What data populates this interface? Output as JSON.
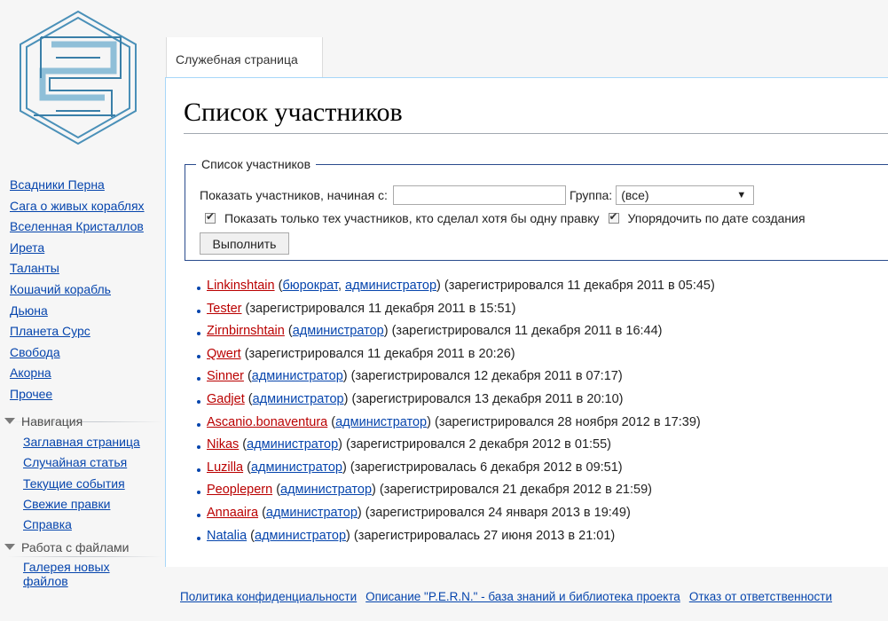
{
  "tab": {
    "label": "Служебная страница"
  },
  "page": {
    "title": "Список участников"
  },
  "form": {
    "legend": "Список участников",
    "from_label": "Показать участников, начиная с:",
    "from_value": "",
    "group_label": "Группа:",
    "group_value": "(все)",
    "edits_label": "Показать только тех участников, кто сделал хотя бы одну правку",
    "sort_label": "Упорядочить по дате создания",
    "submit_label": "Выполнить"
  },
  "sidebar": {
    "top_links": [
      "Всадники Перна",
      "Сага о живых кораблях",
      "Вселенная Кристаллов",
      "Ирета",
      "Таланты",
      "Кошачий корабль",
      "Дьюна",
      "Планета Сурс",
      "Свобода",
      "Акорна",
      "Прочее"
    ],
    "navigation": {
      "title": "Навигация",
      "items": [
        "Заглавная страница",
        "Случайная статья",
        "Текущие события",
        "Свежие правки",
        "Справка"
      ]
    },
    "files": {
      "title": "Работа с файлами",
      "items": [
        "Галерея новых файлов"
      ]
    }
  },
  "users": [
    {
      "name": "Linkinshtain",
      "state": "new",
      "groups": [
        "бюрократ",
        "администратор"
      ],
      "reg": "(зарегистрировался 11 декабря 2011 в 05:45)"
    },
    {
      "name": "Tester",
      "state": "new",
      "groups": [],
      "reg": "(зарегистрировался 11 декабря 2011 в 15:51)"
    },
    {
      "name": "Zirnbirnshtain",
      "state": "new",
      "groups": [
        "администратор"
      ],
      "reg": "(зарегистрировался 11 декабря 2011 в 16:44)"
    },
    {
      "name": "Qwert",
      "state": "new",
      "groups": [],
      "reg": "(зарегистрировался 11 декабря 2011 в 20:26)"
    },
    {
      "name": "Sinner",
      "state": "new",
      "groups": [
        "администратор"
      ],
      "reg": "(зарегистрировался 12 декабря 2011 в 07:17)"
    },
    {
      "name": "Gadjet",
      "state": "new",
      "groups": [
        "администратор"
      ],
      "reg": "(зарегистрировался 13 декабря 2011 в 20:10)"
    },
    {
      "name": "Ascanio.bonaventura",
      "state": "new",
      "groups": [
        "администратор"
      ],
      "reg": "(зарегистрировался 28 ноября 2012 в 17:39)"
    },
    {
      "name": "Nikas",
      "state": "new",
      "groups": [
        "администратор"
      ],
      "reg": "(зарегистрировался 2 декабря 2012 в 01:55)"
    },
    {
      "name": "Luzilla",
      "state": "new",
      "groups": [
        "администратор"
      ],
      "reg": "(зарегистрировалась 6 декабря 2012 в 09:51)"
    },
    {
      "name": "Peoplepern",
      "state": "new",
      "groups": [
        "администратор"
      ],
      "reg": "(зарегистрировался 21 декабря 2012 в 21:59)"
    },
    {
      "name": "Annaaira",
      "state": "new",
      "groups": [
        "администратор"
      ],
      "reg": "(зарегистрировался 24 января 2013 в 19:49)"
    },
    {
      "name": "Natalia",
      "state": "exists",
      "groups": [
        "администратор"
      ],
      "reg": "(зарегистрировалась 27 июня 2013 в 21:01)"
    }
  ],
  "footer": {
    "links": [
      "Политика конфиденциальности",
      "Описание \"P.E.R.N.\" - база знаний и библиотека проекта",
      "Отказ от ответственности"
    ]
  },
  "colors": {
    "link": "#0645ad",
    "new_link": "#ba0000",
    "border": "#a7d7f9"
  }
}
